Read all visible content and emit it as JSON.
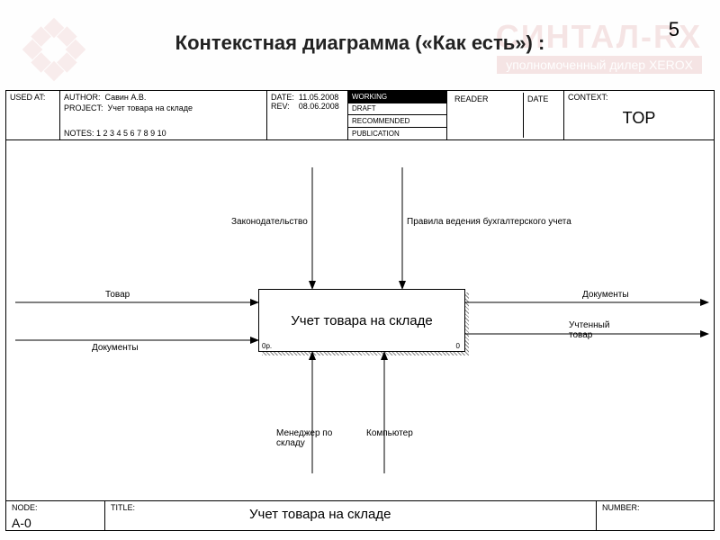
{
  "page_number": "5",
  "title": "Контекстная диаграмма («Как есть») :",
  "watermark": {
    "brand": "СИНТАЛ-RX",
    "sub": "уполномоченный дилер XEROX"
  },
  "header": {
    "used_at": "USED AT:",
    "author_lbl": "AUTHOR:",
    "author": "Савин А.В.",
    "project_lbl": "PROJECT:",
    "project": "Учет товара на складе",
    "notes_lbl": "NOTES:",
    "notes": "1 2 3 4 5 6 7 8 9 10",
    "date_lbl": "DATE:",
    "date": "11.05.2008",
    "rev_lbl": "REV:",
    "rev": "08.06.2008",
    "status": {
      "working": "WORKING",
      "draft": "DRAFT",
      "recommended": "RECOMMENDED",
      "publication": "PUBLICATION"
    },
    "reader_lbl": "READER",
    "reader_date_lbl": "DATE",
    "context_lbl": "CONTEXT:",
    "context_val": "TOP"
  },
  "diagram": {
    "box_title": "Учет товара на складе",
    "box_ref_left": "0р.",
    "box_ref_right": "0",
    "inputs": {
      "top": "Товар",
      "bottom": "Документы"
    },
    "controls": {
      "left": "Законодательство",
      "right": "Правила ведения бухгалтерского учета"
    },
    "outputs": {
      "top": "Документы",
      "bottom": "Учтенный товар"
    },
    "mechanisms": {
      "left": "Менеджер по складу",
      "right": "Компьютер"
    }
  },
  "footer": {
    "node_lbl": "NODE:",
    "node_val": "A-0",
    "title_lbl": "TITLE:",
    "title_val": "Учет товара на складе",
    "number_lbl": "NUMBER:"
  }
}
